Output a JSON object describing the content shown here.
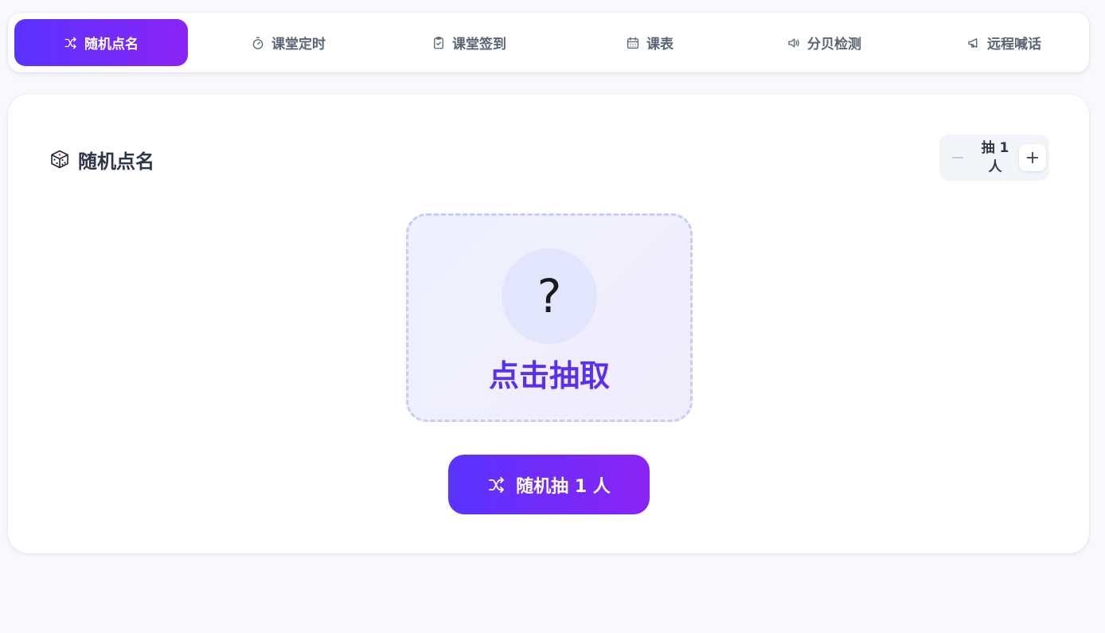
{
  "tabs": [
    {
      "label": "随机点名",
      "icon": "shuffle-icon",
      "active": true
    },
    {
      "label": "课堂定时",
      "icon": "timer-icon",
      "active": false
    },
    {
      "label": "课堂签到",
      "icon": "clipboard-check-icon",
      "active": false
    },
    {
      "label": "课表",
      "icon": "calendar-icon",
      "active": false
    },
    {
      "label": "分贝检测",
      "icon": "volume-icon",
      "active": false
    },
    {
      "label": "远程喊话",
      "icon": "megaphone-icon",
      "active": false
    }
  ],
  "card": {
    "title": "随机点名",
    "title_icon": "dice-icon"
  },
  "stepper": {
    "label": "抽 1 人",
    "minus_symbol": "−",
    "plus_symbol": "+",
    "count": 1
  },
  "draw_area": {
    "placeholder_symbol": "?",
    "prompt": "点击抽取"
  },
  "draw_button": {
    "label": "随机抽 1 人",
    "icon": "shuffle-icon"
  },
  "colors": {
    "accent_start": "#5a33ff",
    "accent_end": "#8a24f5",
    "prompt_text": "#5b2ff0",
    "background": "#f7f9fc"
  }
}
